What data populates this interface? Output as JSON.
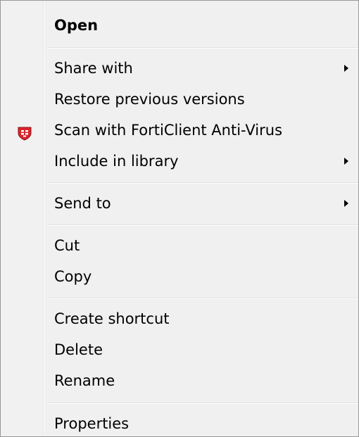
{
  "menu": {
    "items": {
      "open": {
        "label": "Open"
      },
      "share_with": {
        "label": "Share with"
      },
      "restore": {
        "label": "Restore previous versions"
      },
      "scan": {
        "label": "Scan with FortiClient Anti-Virus",
        "icon": "forticlient-shield-icon"
      },
      "include_library": {
        "label": "Include in library"
      },
      "send_to": {
        "label": "Send to"
      },
      "cut": {
        "label": "Cut"
      },
      "copy": {
        "label": "Copy"
      },
      "create_shortcut": {
        "label": "Create shortcut"
      },
      "delete": {
        "label": "Delete"
      },
      "rename": {
        "label": "Rename"
      },
      "properties": {
        "label": "Properties"
      }
    },
    "submenu_icon": "chevron-right-icon",
    "colors": {
      "background": "#f0f0f0",
      "border": "#979797",
      "separator": "#e0e0e0",
      "forticlient_red": "#d8262c"
    }
  }
}
